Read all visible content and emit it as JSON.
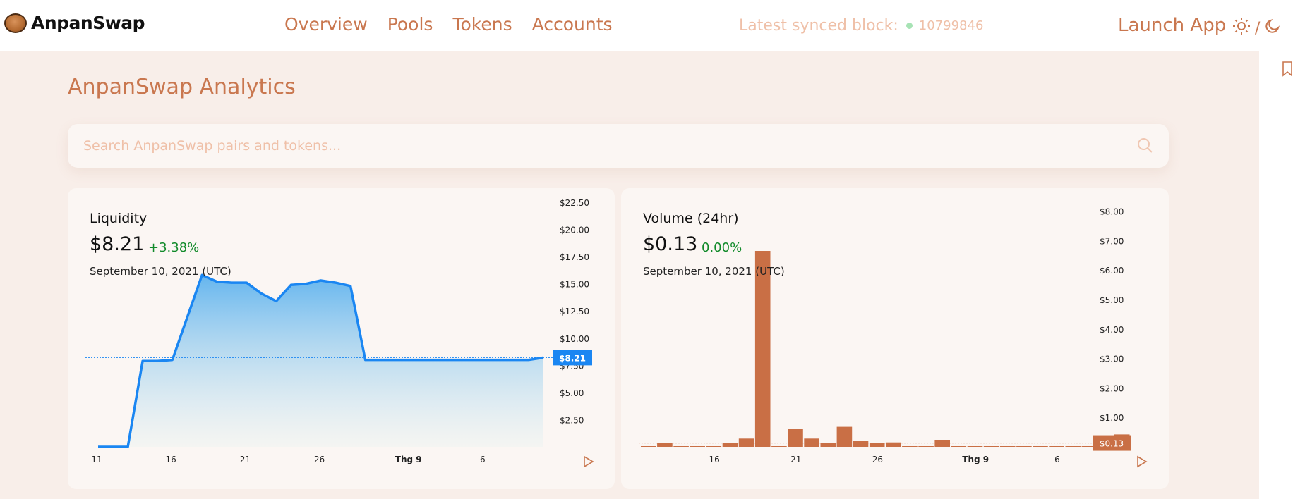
{
  "header": {
    "logo_text": "AnpanSwap",
    "nav": [
      "Overview",
      "Pools",
      "Tokens",
      "Accounts"
    ],
    "sync_label": "Latest synced block:",
    "sync_block": "10799846",
    "launch_label": "Launch App",
    "theme_separator": "/"
  },
  "page": {
    "title": "AnpanSwap Analytics"
  },
  "search": {
    "placeholder": "Search AnpanSwap pairs and tokens...",
    "value": ""
  },
  "colors": {
    "accent": "#c9774f",
    "line": "#1a86f2",
    "bar": "#c96f45",
    "positive": "#118a2a"
  },
  "icons": [
    "anpan-logo-icon",
    "sun-icon",
    "moon-icon",
    "bookmark-icon",
    "search-icon",
    "play-icon"
  ],
  "liquidity": {
    "title": "Liquidity",
    "value": "$8.21",
    "change": "+3.38%",
    "date": "September 10, 2021 (UTC)",
    "current_label": "$8.21"
  },
  "volume": {
    "title": "Volume (24hr)",
    "value": "$0.13",
    "change": "0.00%",
    "date": "September 10, 2021 (UTC)",
    "current_label": "$0.13"
  },
  "chart_data": [
    {
      "type": "area",
      "title": "Liquidity",
      "y_ticks": [
        "$2.50",
        "$5.00",
        "$7.50",
        "$10.00",
        "$12.50",
        "$15.00",
        "$17.50",
        "$20.00",
        "$22.50"
      ],
      "x_ticks": [
        "11",
        "16",
        "21",
        "26",
        "Thg 9",
        "6"
      ],
      "ylim": [
        0,
        22.5
      ],
      "x": [
        "Aug 11",
        "Aug 12",
        "Aug 13",
        "Aug 14",
        "Aug 15",
        "Aug 16",
        "Aug 17",
        "Aug 18",
        "Aug 19",
        "Aug 20",
        "Aug 21",
        "Aug 22",
        "Aug 23",
        "Aug 24",
        "Aug 25",
        "Aug 26",
        "Aug 27",
        "Aug 28",
        "Aug 29",
        "Aug 30",
        "Aug 31",
        "Sep 1",
        "Sep 2",
        "Sep 3",
        "Sep 4",
        "Sep 5",
        "Sep 6",
        "Sep 7",
        "Sep 8",
        "Sep 9",
        "Sep 10"
      ],
      "values": [
        0,
        0,
        0,
        7.9,
        7.9,
        8.0,
        11.9,
        15.8,
        15.2,
        15.1,
        15.1,
        14.1,
        13.4,
        14.9,
        15.0,
        15.3,
        15.1,
        14.8,
        8.0,
        8.0,
        8.0,
        8.0,
        8.0,
        8.0,
        8.0,
        8.0,
        8.0,
        8.0,
        8.0,
        8.0,
        8.21
      ],
      "current": 8.21,
      "grid": false,
      "legend": "none"
    },
    {
      "type": "bar",
      "title": "Volume (24hr)",
      "y_ticks": [
        "$1.00",
        "$2.00",
        "$3.00",
        "$4.00",
        "$5.00",
        "$6.00",
        "$7.00",
        "$8.00"
      ],
      "x_ticks": [
        "16",
        "21",
        "26",
        "Thg 9",
        "6"
      ],
      "ylim": [
        0,
        8.3
      ],
      "x": [
        "Aug 12",
        "Aug 13",
        "Aug 14",
        "Aug 15",
        "Aug 16",
        "Aug 17",
        "Aug 18",
        "Aug 19",
        "Aug 20",
        "Aug 21",
        "Aug 22",
        "Aug 23",
        "Aug 24",
        "Aug 25",
        "Aug 26",
        "Aug 27",
        "Aug 28",
        "Aug 29",
        "Aug 30",
        "Aug 31",
        "Sep 1",
        "Sep 2",
        "Sep 3",
        "Sep 4",
        "Sep 5",
        "Sep 6",
        "Sep 7",
        "Sep 8",
        "Sep 9",
        "Sep 10"
      ],
      "values": [
        0.02,
        0.12,
        0.0,
        0.0,
        0.0,
        0.14,
        0.28,
        6.65,
        0.0,
        0.6,
        0.28,
        0.13,
        0.68,
        0.2,
        0.12,
        0.15,
        0.0,
        0.0,
        0.24,
        0.0,
        0.0,
        0.0,
        0.0,
        0.0,
        0.0,
        0.0,
        0.0,
        0.0,
        0.0,
        0.42
      ],
      "current": 0.13,
      "grid": false,
      "legend": "none"
    }
  ]
}
